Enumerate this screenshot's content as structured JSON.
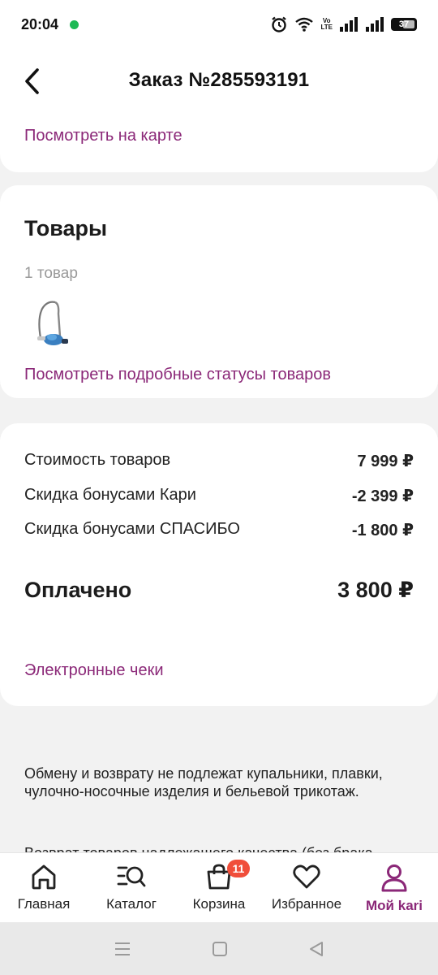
{
  "status_bar": {
    "time": "20:04",
    "volte_line1": "Vo",
    "volte_line2": "LTE",
    "battery": "37"
  },
  "header": {
    "title": "Заказ №285593191",
    "back_icon": "chevron-left-icon"
  },
  "map_card": {
    "link": "Посмотреть на карте"
  },
  "goods_card": {
    "title": "Товары",
    "count": "1 товар",
    "thumb_icon": "vacuum-cleaner-thumbnail",
    "link": "Посмотреть подробные статусы товаров"
  },
  "summary_card": {
    "rows": [
      {
        "label": "Стоимость товаров",
        "value": "7 999 ₽"
      },
      {
        "label": "Скидка бонусами Кари",
        "value": "-2 399 ₽"
      },
      {
        "label": "Скидка бонусами СПАСИБО",
        "value": "-1 800 ₽"
      }
    ],
    "paid_label": "Оплачено",
    "paid_value": "3 800 ₽",
    "receipts_link": "Электронные чеки"
  },
  "notice": {
    "paragraph1": "Обмену и возврату не подлежат купальники, плавки, чулочно-носочные изделия и бельевой трикотаж.",
    "paragraph2": "Возврат товаров надлежащего качества (без брака"
  },
  "tabbar": {
    "tabs": [
      {
        "label": "Главная",
        "icon": "home-icon"
      },
      {
        "label": "Каталог",
        "icon": "catalog-search-icon"
      },
      {
        "label": "Корзина",
        "icon": "shopping-bag-icon",
        "badge": "11"
      },
      {
        "label": "Избранное",
        "icon": "heart-icon"
      },
      {
        "label": "Мой kari",
        "icon": "profile-icon",
        "active": true
      }
    ]
  },
  "colors": {
    "accent": "#8b2878",
    "badge": "#f04e3a",
    "background": "#f2f2f2"
  }
}
